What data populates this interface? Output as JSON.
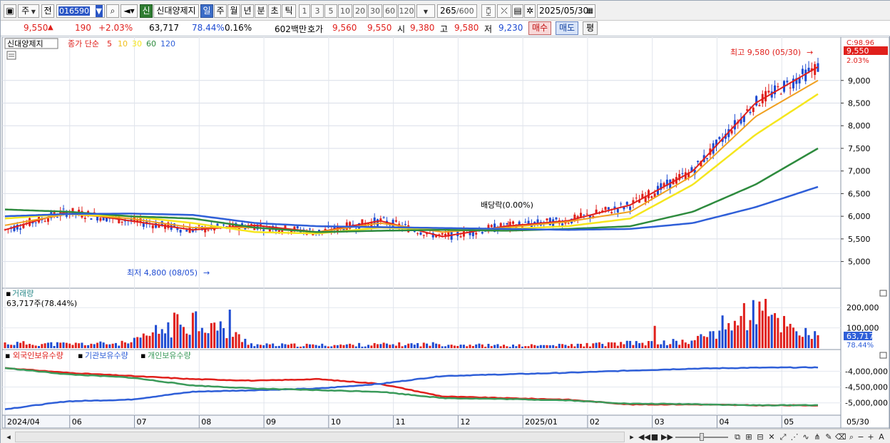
{
  "toolbar": {
    "market": "주",
    "prev_label": "전",
    "code": "016590",
    "badge": "신",
    "stock_name": "신대양제지",
    "periods": [
      "일",
      "주",
      "월",
      "년",
      "분",
      "초",
      "틱"
    ],
    "selected_period": "일",
    "intervals": [
      "1",
      "3",
      "5",
      "10",
      "20",
      "30",
      "60",
      "120"
    ],
    "count": "265",
    "count_total": "/600",
    "date": "2025/05/30"
  },
  "quote": {
    "price": "9,550",
    "change": "190",
    "change_pct": "+2.03%",
    "volume": "63,717",
    "volume_ratio": "78.44%",
    "turnover": "0.16%",
    "amount": "602백만",
    "hoga_label": "호가",
    "ask": "9,560",
    "bid": "9,550",
    "open_label": "시",
    "open": "9,380",
    "high_label": "고",
    "high": "9,580",
    "low_label": "저",
    "low": "9,230",
    "buy_label": "매수",
    "sell_label": "매도",
    "eval_label": "평"
  },
  "price_panel": {
    "legend": {
      "name": "신대양제지",
      "ma_label": "종가 단순",
      "periods": [
        "5",
        "10",
        "30",
        "60",
        "120"
      ],
      "colors": [
        "#e0201c",
        "#f0c020",
        "#f5e61e",
        "#2e8b3e",
        "#2f5fd8"
      ]
    },
    "y_ticks": [
      "9,000",
      "8,500",
      "8,000",
      "7,500",
      "7,000",
      "6,500",
      "6,000",
      "5,500",
      "5,000"
    ],
    "c_label": "C:98.96",
    "price_tag": "9,550",
    "pct_tag": "2.03%",
    "high_note": "최고 9,580 (05/30)",
    "low_note": "최저 4,800 (08/05)",
    "dividend_note": "배당락(0.00%)"
  },
  "volume_panel": {
    "title": "거래량",
    "subtitle": "63,717주(78.44%)",
    "y_ticks": [
      "200,000",
      "100,000"
    ],
    "vol_tag": "63,717",
    "ratio_tag": "78.44%"
  },
  "holding_panel": {
    "series": [
      "외국인보유수량",
      "기관보유수량",
      "개인보유수량"
    ],
    "y_ticks": [
      "-4,000,000",
      "-4,500,000",
      "-5,000,000"
    ]
  },
  "x_axis": {
    "labels": [
      "2024/04",
      "06",
      "07",
      "08",
      "09",
      "10",
      "11",
      "12",
      "2025/01",
      "02",
      "03",
      "04",
      "05"
    ],
    "last_date": "05/30"
  },
  "chart_data": [
    {
      "type": "line",
      "title": "신대양제지",
      "ylabel": "",
      "ylim": [
        4600,
        9800
      ],
      "x": [
        "2024/04",
        "06",
        "07",
        "08",
        "09",
        "10",
        "11",
        "12",
        "2025/01",
        "02",
        "03",
        "04",
        "05",
        "05/30"
      ],
      "series": [
        {
          "name": "5",
          "values": [
            5700,
            6100,
            5900,
            5700,
            5800,
            5650,
            5900,
            5550,
            5780,
            5900,
            6250,
            7000,
            8500,
            9300
          ]
        },
        {
          "name": "10",
          "values": [
            5800,
            6050,
            5950,
            5750,
            5750,
            5650,
            5850,
            5650,
            5750,
            5880,
            6100,
            6900,
            8200,
            9000
          ]
        },
        {
          "name": "30",
          "values": [
            5950,
            6050,
            6000,
            5850,
            5650,
            5620,
            5750,
            5700,
            5720,
            5780,
            5950,
            6700,
            7800,
            8700
          ]
        },
        {
          "name": "60",
          "values": [
            6150,
            6100,
            6000,
            5950,
            5750,
            5650,
            5680,
            5700,
            5680,
            5720,
            5780,
            6100,
            6700,
            7500
          ]
        },
        {
          "name": "120",
          "values": [
            6000,
            6050,
            6060,
            6030,
            5850,
            5780,
            5760,
            5740,
            5720,
            5700,
            5720,
            5850,
            6200,
            6650
          ]
        }
      ],
      "annotations": [
        "최고 9,580 (05/30)",
        "최저 4,800 (08/05)",
        "배당락(0.00%)"
      ]
    },
    {
      "type": "bar",
      "title": "거래량",
      "ylim": [
        0,
        250000
      ],
      "x": [
        "2024/04",
        "06",
        "07",
        "08",
        "09",
        "10",
        "11",
        "12",
        "2025/01",
        "02",
        "03",
        "04",
        "05",
        "05/30"
      ],
      "values": [
        30000,
        25000,
        30000,
        190000,
        20000,
        18000,
        22000,
        25000,
        15000,
        18000,
        30000,
        40000,
        230000,
        63717
      ]
    },
    {
      "type": "line",
      "title": "",
      "ylim": [
        -5300000,
        -3700000
      ],
      "x": [
        "2024/04",
        "06",
        "07",
        "08",
        "09",
        "10",
        "11",
        "12",
        "2025/01",
        "02",
        "03",
        "04",
        "05",
        "05/30"
      ],
      "series": [
        {
          "name": "외국인보유수량",
          "values": [
            -3900000,
            -4050000,
            -4150000,
            -4250000,
            -4300000,
            -4250000,
            -4400000,
            -4800000,
            -4850000,
            -4900000,
            -5050000,
            -5050000,
            -5080000,
            -5080000
          ]
        },
        {
          "name": "기관보유수량",
          "values": [
            -5200000,
            -4950000,
            -4900000,
            -4650000,
            -4600000,
            -4550000,
            -4400000,
            -4150000,
            -4100000,
            -4050000,
            -3980000,
            -3920000,
            -3890000,
            -3880000
          ]
        },
        {
          "name": "개인보유수량",
          "values": [
            -3900000,
            -4100000,
            -4200000,
            -4450000,
            -4550000,
            -4600000,
            -4650000,
            -4850000,
            -4880000,
            -4920000,
            -5030000,
            -5040000,
            -5080000,
            -5070000
          ]
        }
      ]
    }
  ],
  "colors": {
    "up": "#e0201c",
    "down": "#1e4bd2",
    "ma5": "#e0201c",
    "ma10": "#f0a020",
    "ma30": "#f5e61e",
    "ma60": "#2e8b3e",
    "ma120": "#2f5fd8",
    "foreign": "#e0201c",
    "institution": "#2f5fd8",
    "individual": "#3a9a5a"
  }
}
